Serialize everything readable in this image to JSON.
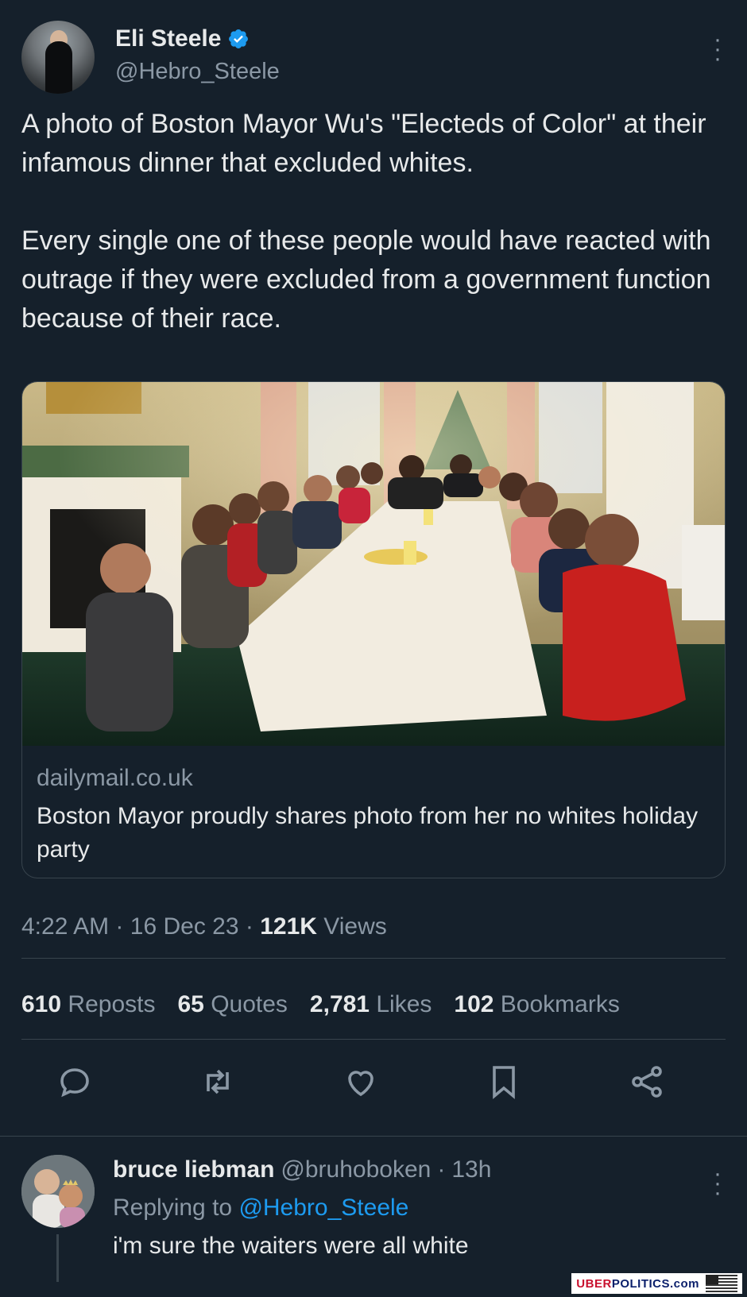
{
  "author": {
    "display_name": "Eli Steele",
    "handle": "@Hebro_Steele",
    "verified": true,
    "avatar_icon": "profile-photo-icon"
  },
  "tweet": {
    "paragraph_1": "A photo of Boston Mayor Wu's \"Electeds of Color\" at their infamous dinner that excluded whites.",
    "paragraph_2": "Every single one of these people would have reacted with outrage if they were excluded from a government function because of their race."
  },
  "link_card": {
    "image_icon": "dinner-party-photo",
    "domain": "dailymail.co.uk",
    "title": "Boston Mayor proudly shares photo from her no whites holiday party"
  },
  "meta": {
    "time": "4:22 AM",
    "date": "16 Dec 23",
    "separator": "·",
    "views_count": "121K",
    "views_label": "Views"
  },
  "stats": [
    {
      "count": "610",
      "label": "Reposts"
    },
    {
      "count": "65",
      "label": "Quotes"
    },
    {
      "count": "2,781",
      "label": "Likes"
    },
    {
      "count": "102",
      "label": "Bookmarks"
    }
  ],
  "actions": [
    {
      "name": "reply",
      "icon": "reply-icon"
    },
    {
      "name": "repost",
      "icon": "repost-icon"
    },
    {
      "name": "like",
      "icon": "heart-icon"
    },
    {
      "name": "bookmark",
      "icon": "bookmark-icon"
    },
    {
      "name": "share",
      "icon": "share-icon"
    }
  ],
  "reply": {
    "display_name": "bruce liebman",
    "handle": "@bruhoboken",
    "separator": "·",
    "time": "13h",
    "replying_prefix": "Replying to",
    "replying_to": "@Hebro_Steele",
    "text": "i'm sure the waiters were all white"
  },
  "watermark": {
    "part_1": "UBER",
    "part_2": "POLITICS",
    "part_3": ".com"
  },
  "colors": {
    "background": "#15202b",
    "text_primary": "#e7e9ea",
    "text_secondary": "#8b98a5",
    "accent": "#1d9bf0",
    "border": "#38444d"
  }
}
